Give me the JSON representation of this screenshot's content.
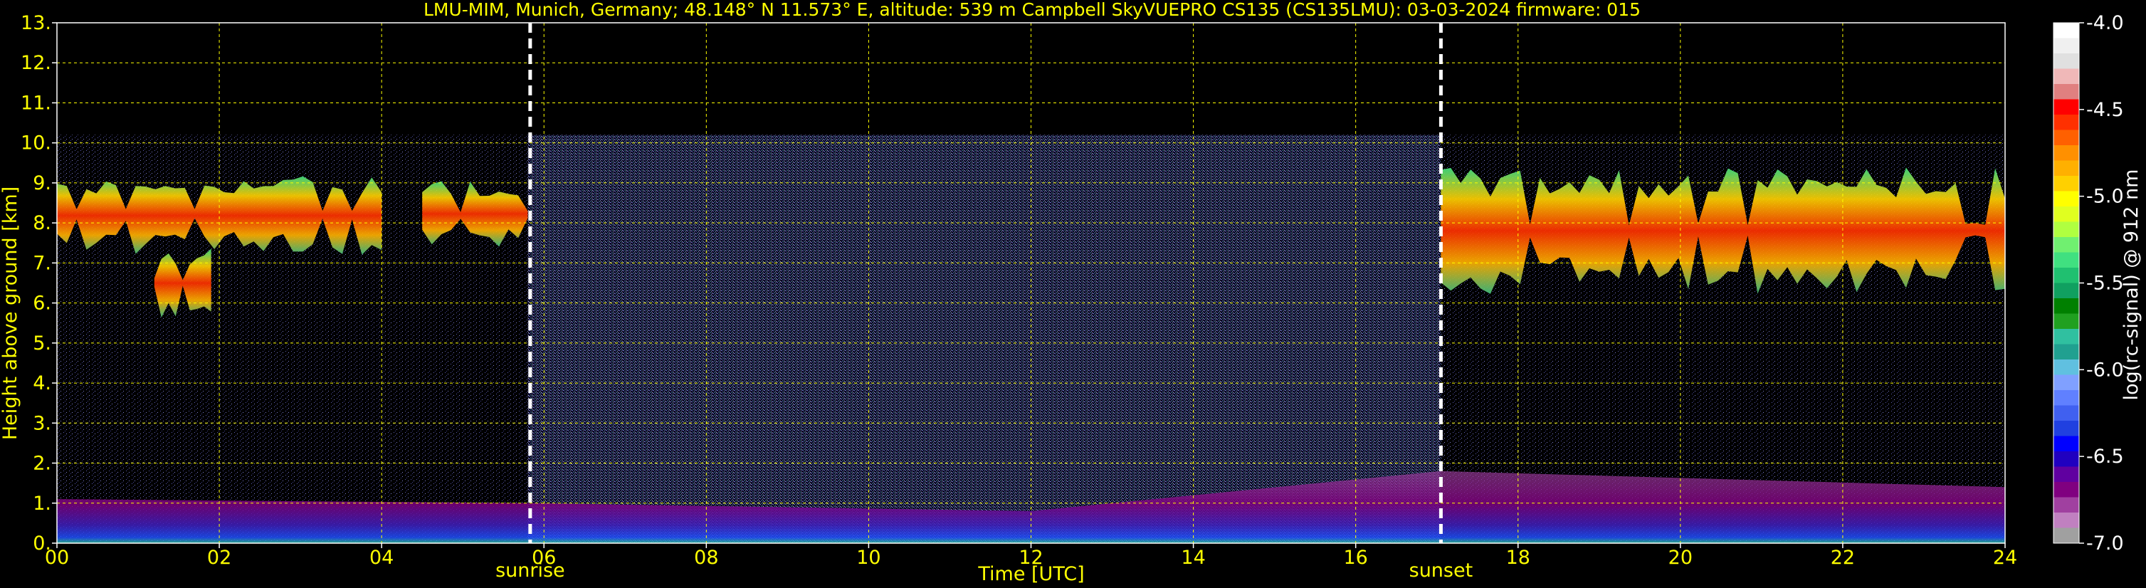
{
  "chart_data": {
    "type": "heatmap",
    "title": "LMU-MIM, Munich, Germany; 48.148° N 11.573° E, altitude: 539 m    Campbell SkyVUEPRO CS135 (CS135LMU): 03-03-2024    firmware: 015",
    "xlabel": "Time [UTC]",
    "ylabel": "Height above ground [km]",
    "xlim": [
      0,
      24
    ],
    "ylim": [
      0,
      13
    ],
    "x_ticks": [
      "00",
      "02",
      "04",
      "06",
      "08",
      "10",
      "12",
      "14",
      "16",
      "18",
      "20",
      "22",
      "24"
    ],
    "y_ticks": [
      "0.",
      "1.",
      "2.",
      "3.",
      "4.",
      "5.",
      "6.",
      "7.",
      "8.",
      "9.",
      "10.",
      "11.",
      "12.",
      "13."
    ],
    "grid": true,
    "colorbar": {
      "label": "log(rc-signal) @ 912 nm",
      "range": [
        -7.0,
        -4.0
      ],
      "ticks": [
        "-4.0",
        "-4.5",
        "-5.0",
        "-5.5",
        "-6.0",
        "-6.5",
        "-7.0"
      ],
      "colors": [
        "#ffffff",
        "#f0f0f0",
        "#e0e0e0",
        "#f0b8b8",
        "#e08080",
        "#ff0000",
        "#ff3000",
        "#ff6000",
        "#ff9000",
        "#ffb000",
        "#ffd000",
        "#ffff00",
        "#e0ff20",
        "#b0ff40",
        "#70f070",
        "#40e080",
        "#20c070",
        "#10a060",
        "#008000",
        "#20a020",
        "#30c0a0",
        "#20a090",
        "#60c0e0",
        "#80a0ff",
        "#6080ff",
        "#4060f0",
        "#2040e0",
        "#0000ff",
        "#2000c0",
        "#6000a0",
        "#800080",
        "#a040a0",
        "#c080c0",
        "#a0a0a0"
      ]
    },
    "events": [
      {
        "label": "sunrise",
        "time": 5.83
      },
      {
        "label": "sunset",
        "time": 17.05
      }
    ],
    "features": {
      "background_noise_top_km": 10.2,
      "noise_band_time": [
        5.8,
        17.05
      ],
      "cloud_layers": [
        {
          "start": 0.0,
          "end": 4.0,
          "base_km": 7.2,
          "top_km": 9.2
        },
        {
          "start": 4.5,
          "end": 5.8,
          "base_km": 7.3,
          "top_km": 9.1
        },
        {
          "start": 1.2,
          "end": 1.9,
          "base_km": 5.6,
          "top_km": 7.4
        },
        {
          "start": 17.05,
          "end": 24.0,
          "base_km": 6.2,
          "top_km": 9.4
        }
      ],
      "boundary_layer_top_km": [
        {
          "time": 0,
          "km": 1.1
        },
        {
          "time": 5.8,
          "km": 1.0
        },
        {
          "time": 12,
          "km": 0.8
        },
        {
          "time": 17.05,
          "km": 1.8
        },
        {
          "time": 24,
          "km": 1.4
        }
      ]
    }
  }
}
